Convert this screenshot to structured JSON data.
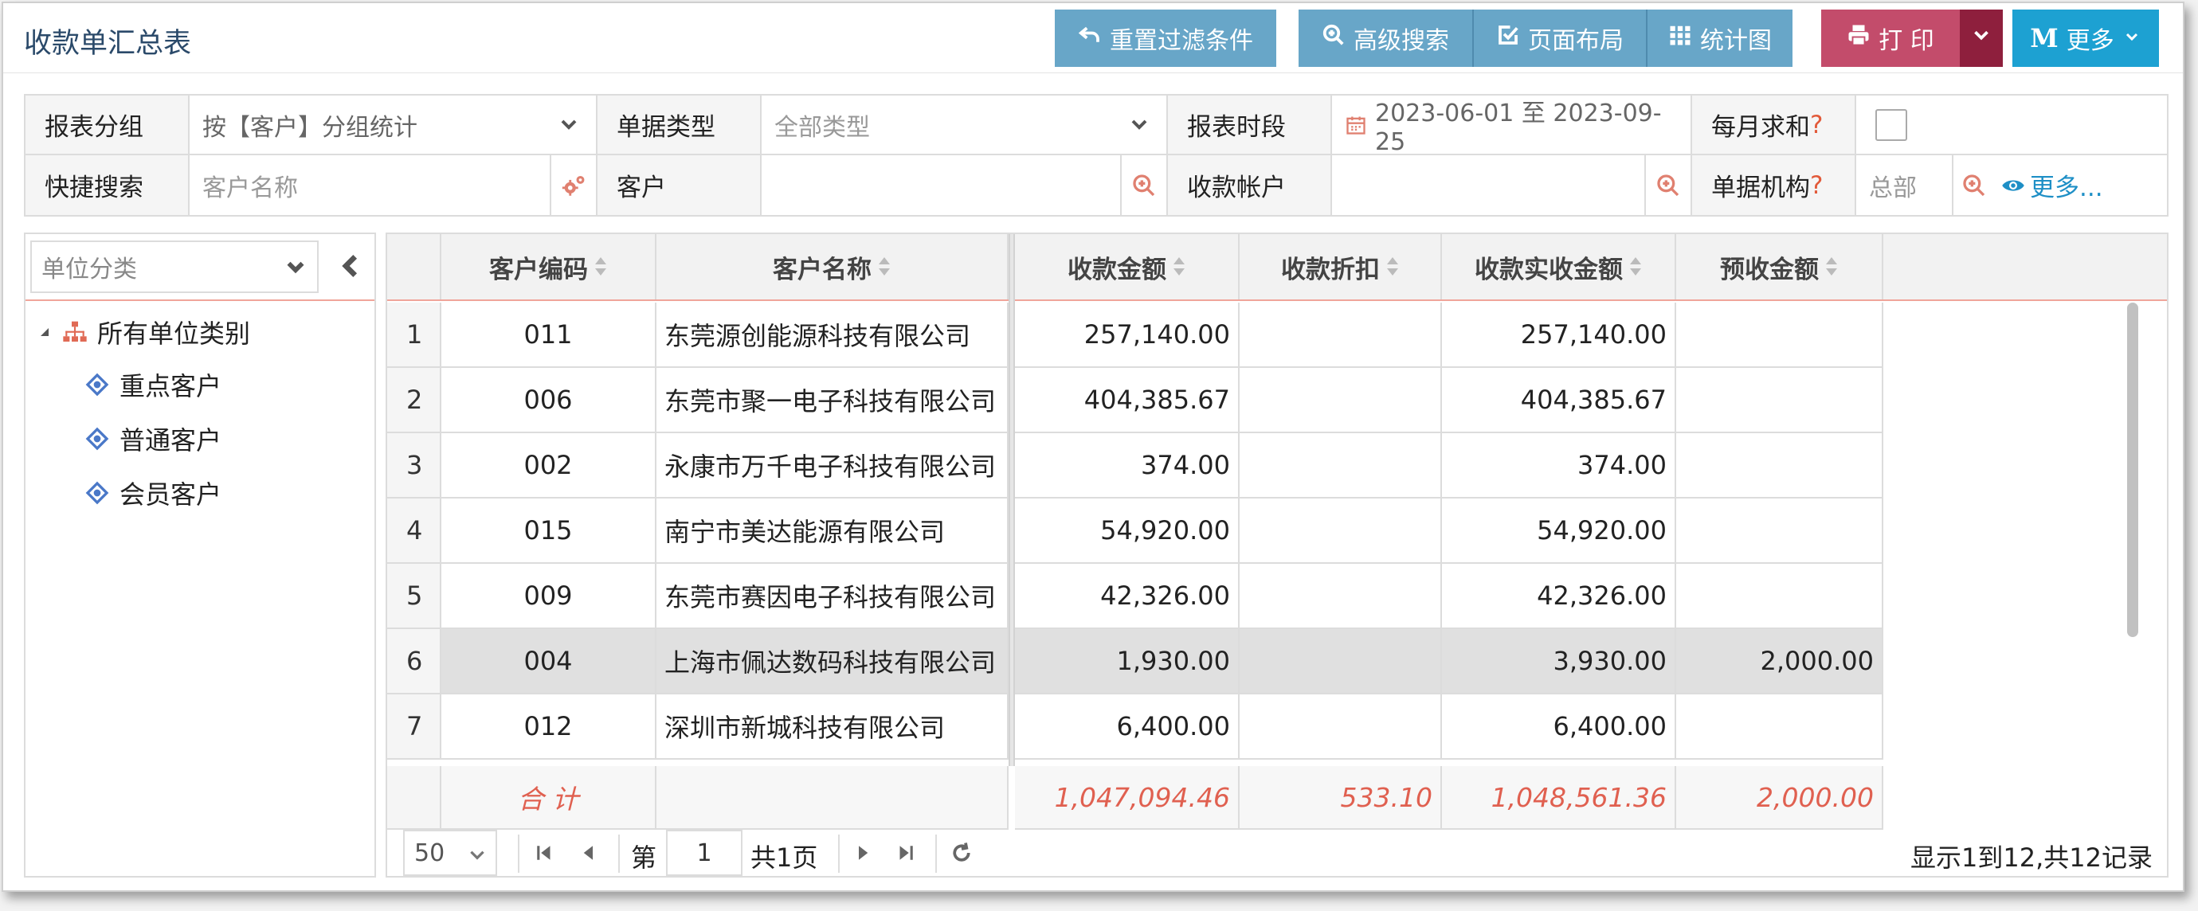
{
  "header": {
    "title": "收款单汇总表",
    "buttons": {
      "reset_filter": "重置过滤条件",
      "advanced_search": "高级搜索",
      "page_layout": "页面布局",
      "chart": "统计图",
      "print": "打 印",
      "more": "更多"
    }
  },
  "filters": {
    "report_group_label": "报表分组",
    "report_group_value": "按【客户】分组统计",
    "doc_type_label": "单据类型",
    "doc_type_value": "全部类型",
    "period_label": "报表时段",
    "period_value": "2023-06-01 至 2023-09-25",
    "monthly_sum_label": "每月求和",
    "qmark": "?",
    "quick_search_label": "快捷搜索",
    "quick_search_placeholder": "客户名称",
    "customer_label": "客户",
    "account_label": "收款帐户",
    "org_label": "单据机构",
    "org_value": "总部",
    "more_link": "更多..."
  },
  "tree": {
    "selector_placeholder": "单位分类",
    "root": "所有单位类别",
    "children": [
      "重点客户",
      "普通客户",
      "会员客户"
    ]
  },
  "grid": {
    "columns": [
      "客户编码",
      "客户名称",
      "收款金额",
      "收款折扣",
      "收款实收金额",
      "预收金额"
    ],
    "rows": [
      {
        "no": "1",
        "code": "011",
        "name": "东莞源创能源科技有限公司",
        "amount": "257,140.00",
        "discount": "",
        "actual": "257,140.00",
        "advance": ""
      },
      {
        "no": "2",
        "code": "006",
        "name": "东莞市聚一电子科技有限公司",
        "amount": "404,385.67",
        "discount": "",
        "actual": "404,385.67",
        "advance": ""
      },
      {
        "no": "3",
        "code": "002",
        "name": "永康市万千电子科技有限公司",
        "amount": "374.00",
        "discount": "",
        "actual": "374.00",
        "advance": ""
      },
      {
        "no": "4",
        "code": "015",
        "name": "南宁市美达能源有限公司",
        "amount": "54,920.00",
        "discount": "",
        "actual": "54,920.00",
        "advance": ""
      },
      {
        "no": "5",
        "code": "009",
        "name": "东莞市赛因电子科技有限公司",
        "amount": "42,326.00",
        "discount": "",
        "actual": "42,326.00",
        "advance": ""
      },
      {
        "no": "6",
        "code": "004",
        "name": "上海市佩达数码科技有限公司",
        "amount": "1,930.00",
        "discount": "",
        "actual": "3,930.00",
        "advance": "2,000.00"
      },
      {
        "no": "7",
        "code": "012",
        "name": "深圳市新城科技有限公司",
        "amount": "6,400.00",
        "discount": "",
        "actual": "6,400.00",
        "advance": ""
      }
    ],
    "totals": {
      "label": "合 计",
      "amount": "1,047,094.46",
      "discount": "533.10",
      "actual": "1,048,561.36",
      "advance": "2,000.00"
    }
  },
  "pager": {
    "page_size": "50",
    "page_prefix": "第",
    "page_current": "1",
    "page_suffix": "共1页",
    "info": "显示1到12,共12记录"
  },
  "colors": {
    "accent_blue": "#68a6c8",
    "print_red": "#c34c6b",
    "more_teal": "#1da1d2",
    "total_red": "#e06050"
  }
}
